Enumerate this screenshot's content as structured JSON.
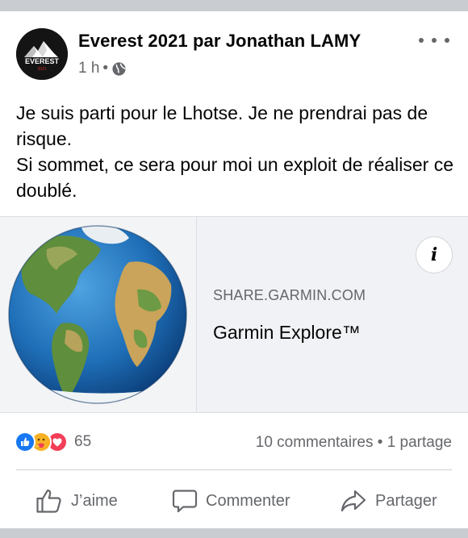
{
  "post": {
    "author": "Everest 2021 par Jonathan LAMY",
    "time": "1 h",
    "separator": "•",
    "avatar_text": "EVEREST",
    "avatar_subtext": "2021",
    "text_lines": [
      "Je suis parti pour le Lhotse. Je ne prendrai pas de risque.",
      "Si sommet, ce sera pour moi un exploit de réaliser ce doublé."
    ]
  },
  "link": {
    "domain": "SHARE.GARMIN.COM",
    "title": "Garmin Explore™",
    "info_label": "i"
  },
  "stats": {
    "reaction_count": "65",
    "comments": "10 commentaires",
    "dot": "•",
    "shares": "1 partage"
  },
  "actions": {
    "like": "J’aime",
    "comment": "Commenter",
    "share": "Partager"
  },
  "icons": {
    "more": "more-horizontal-icon",
    "audience": "globe-icon",
    "like": "thumbs-up-icon",
    "comment": "speech-bubble-icon",
    "share": "share-arrow-icon"
  },
  "colors": {
    "like_blue": "#1877f2",
    "care_yellow": "#f7b125",
    "love_red": "#f33e58",
    "text": "#050505",
    "muted": "#65676b"
  }
}
